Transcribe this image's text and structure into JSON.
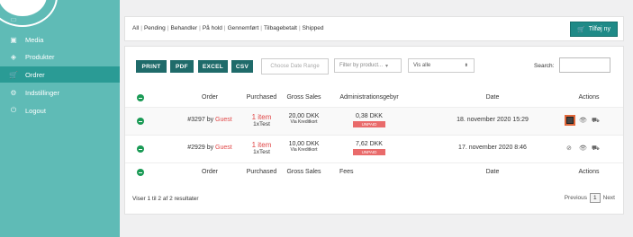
{
  "sidebar": {
    "items": [
      {
        "label": "Media",
        "icon": "media-icon"
      },
      {
        "label": "Produkter",
        "icon": "tag-icon"
      },
      {
        "label": "Ordrer",
        "icon": "cart-icon",
        "active": true
      },
      {
        "label": "Indstillinger",
        "icon": "gear-icon"
      },
      {
        "label": "Logout",
        "icon": "power-icon"
      }
    ]
  },
  "topbar": {
    "filters": [
      "All",
      "Pending",
      "Behandler",
      "På hold",
      "Gennemført",
      "Tilbagebetalt",
      "Shipped"
    ],
    "add_label": "Tilføj ny"
  },
  "toolbar": {
    "print": "PRINT",
    "pdf": "PDF",
    "excel": "EXCEL",
    "csv": "CSV",
    "date_range_placeholder": "Choose Date Range",
    "product_filter": "Filter by product...",
    "visibility": "Vis alle",
    "search_label": "Search:"
  },
  "table": {
    "headers": [
      "Order",
      "Purchased",
      "Gross Sales",
      "Administrationsgebyr",
      "Date",
      "Actions"
    ],
    "footer_headers": [
      "Order",
      "Purchased",
      "Gross Sales",
      "Fees",
      "Date",
      "Actions"
    ],
    "rows": [
      {
        "order_no": "#3297",
        "by": "by",
        "customer": "Guest",
        "items": "1 item",
        "product": "1xTest",
        "gross": "20,00 DKK",
        "gross_via": "Via Kreditkort",
        "fee": "0,38 DKK",
        "status": "UNPAID",
        "date": "18. november 2020 15:29"
      },
      {
        "order_no": "#2929",
        "by": "by",
        "customer": "Guest",
        "items": "1 item",
        "product": "1xTest",
        "gross": "10,00 DKK",
        "gross_via": "Via Kreditkort",
        "fee": "7,62 DKK",
        "status": "UNPAID",
        "date": "17. november 2020 8:46"
      }
    ]
  },
  "footer": {
    "info": "Viser 1 til 2 af 2 resultater",
    "previous": "Previous",
    "page": "1",
    "next": "Next"
  },
  "colors": {
    "sidebar": "#5fbbb6",
    "sidebar_active": "#2a9b95",
    "button": "#1f6b6a",
    "status_unpaid": "#e96b6b",
    "guest": "#e14848",
    "highlight": "#e0673a"
  }
}
